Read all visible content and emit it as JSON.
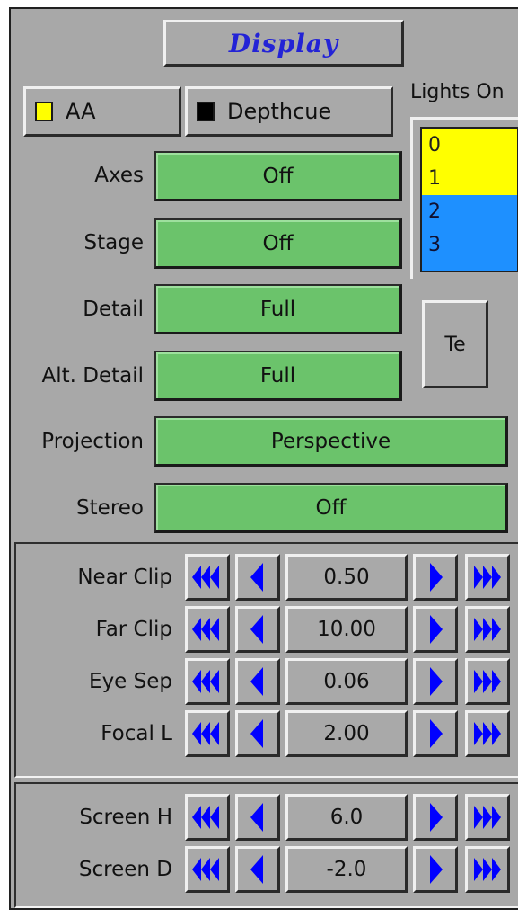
{
  "header": {
    "title": "Display"
  },
  "toggles": {
    "aa": {
      "label": "AA",
      "state": "on",
      "color": "#ffff00"
    },
    "depthcue": {
      "label": "Depthcue",
      "state": "off",
      "color": "#000000"
    }
  },
  "settings": {
    "axes": {
      "label": "Axes",
      "value": "Off"
    },
    "stage": {
      "label": "Stage",
      "value": "Off"
    },
    "detail": {
      "label": "Detail",
      "value": "Full"
    },
    "alt_detail": {
      "label": "Alt. Detail",
      "value": "Full"
    },
    "projection": {
      "label": "Projection",
      "value": "Perspective"
    },
    "stereo": {
      "label": "Stereo",
      "value": "Off"
    }
  },
  "lights": {
    "title": "Lights On",
    "items": [
      {
        "label": "0",
        "selected": true
      },
      {
        "label": "1",
        "selected": true
      },
      {
        "label": "2",
        "selected": false
      },
      {
        "label": "3",
        "selected": false
      }
    ],
    "te_button": "Te",
    "colors": {
      "selected": "#ffff00",
      "list_bg": "#1e90ff"
    }
  },
  "clip_group": {
    "rows": [
      {
        "label": "Near Clip",
        "value": "0.50"
      },
      {
        "label": "Far Clip",
        "value": "10.00"
      },
      {
        "label": "Eye Sep",
        "value": "0.06"
      },
      {
        "label": "Focal L",
        "value": "2.00"
      }
    ]
  },
  "screen_group": {
    "rows": [
      {
        "label": "Screen H",
        "value": "6.0"
      },
      {
        "label": "Screen D",
        "value": "-2.0"
      }
    ]
  },
  "colors": {
    "panel": "#a8a8a8",
    "accent_green": "#6bc36b",
    "arrow_blue": "#0000ff",
    "title_blue": "#2323d6"
  },
  "icons": [
    "fast-rewind-icon",
    "step-left-icon",
    "step-right-icon",
    "fast-forward-icon"
  ]
}
